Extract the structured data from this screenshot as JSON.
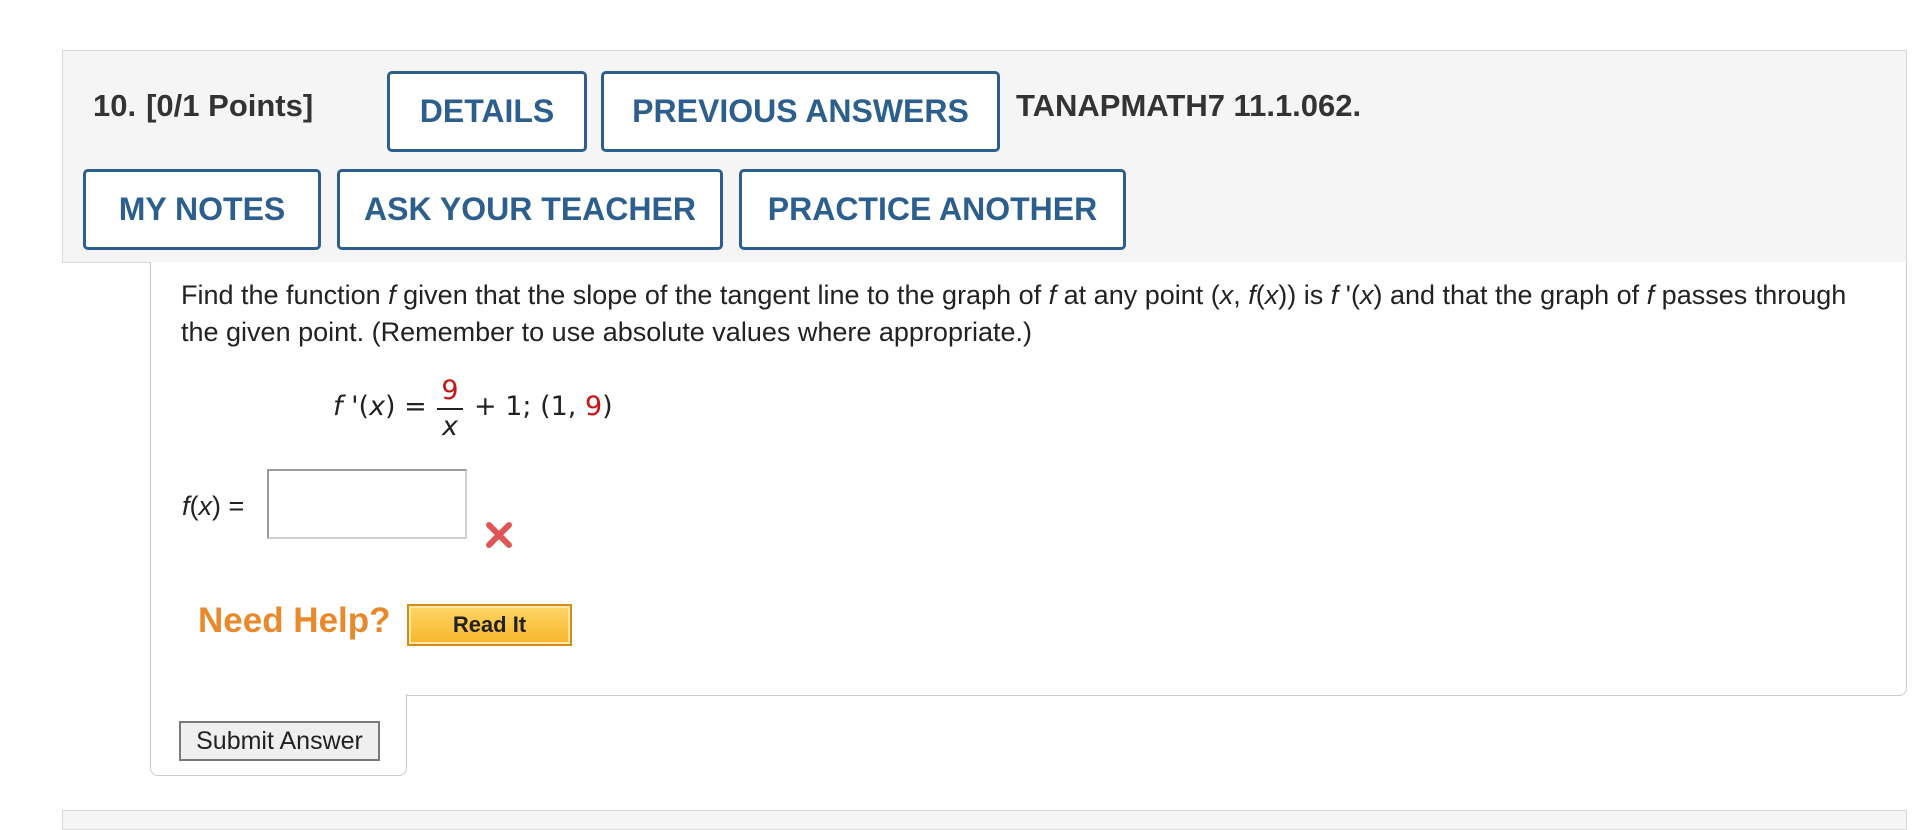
{
  "question": {
    "number": "10.",
    "points": "[0/1 Points]",
    "id": "TANAPMATH7 11.1.062."
  },
  "buttons": {
    "details": "DETAILS",
    "previous_answers": "PREVIOUS ANSWERS",
    "my_notes": "MY NOTES",
    "ask_teacher": "ASK YOUR TEACHER",
    "practice_another": "PRACTICE ANOTHER"
  },
  "problem": {
    "p1": "Find the function ",
    "v1": "f",
    "p2": " given that the slope of the tangent line to the graph of ",
    "v2": "f",
    "p3": " at any point (",
    "v3": "x",
    "p4": ", ",
    "v4": "f",
    "p5": "(",
    "v5": "x",
    "p6": ")) is ",
    "v6": "f",
    "p7": " '(",
    "v7": "x",
    "p8": ") and that the graph of ",
    "v8": "f",
    "p9": " passes through the given point. (Remember to use absolute values where appropriate.)"
  },
  "formula": {
    "lhs_f": "f",
    "lhs_rest": " '(",
    "lhs_x": "x",
    "lhs_end": ")  =",
    "numerator": "9",
    "denominator": "x",
    "rest_prefix": "+ 1; (1, ",
    "point_y": "9",
    "rest_suffix": ")"
  },
  "answer": {
    "label_f": "f",
    "label_open": "(",
    "label_x": "x",
    "label_close": ")  =",
    "value": "",
    "status": "incorrect",
    "status_icon": "x-mark-icon"
  },
  "help": {
    "title": "Need Help?",
    "read_it": "Read It"
  },
  "submit": {
    "label": "Submit Answer"
  },
  "colors": {
    "accent": "#2c5f8e",
    "help": "#e8892b",
    "wrong": "#e05656",
    "highlight_red": "#cc1111"
  }
}
